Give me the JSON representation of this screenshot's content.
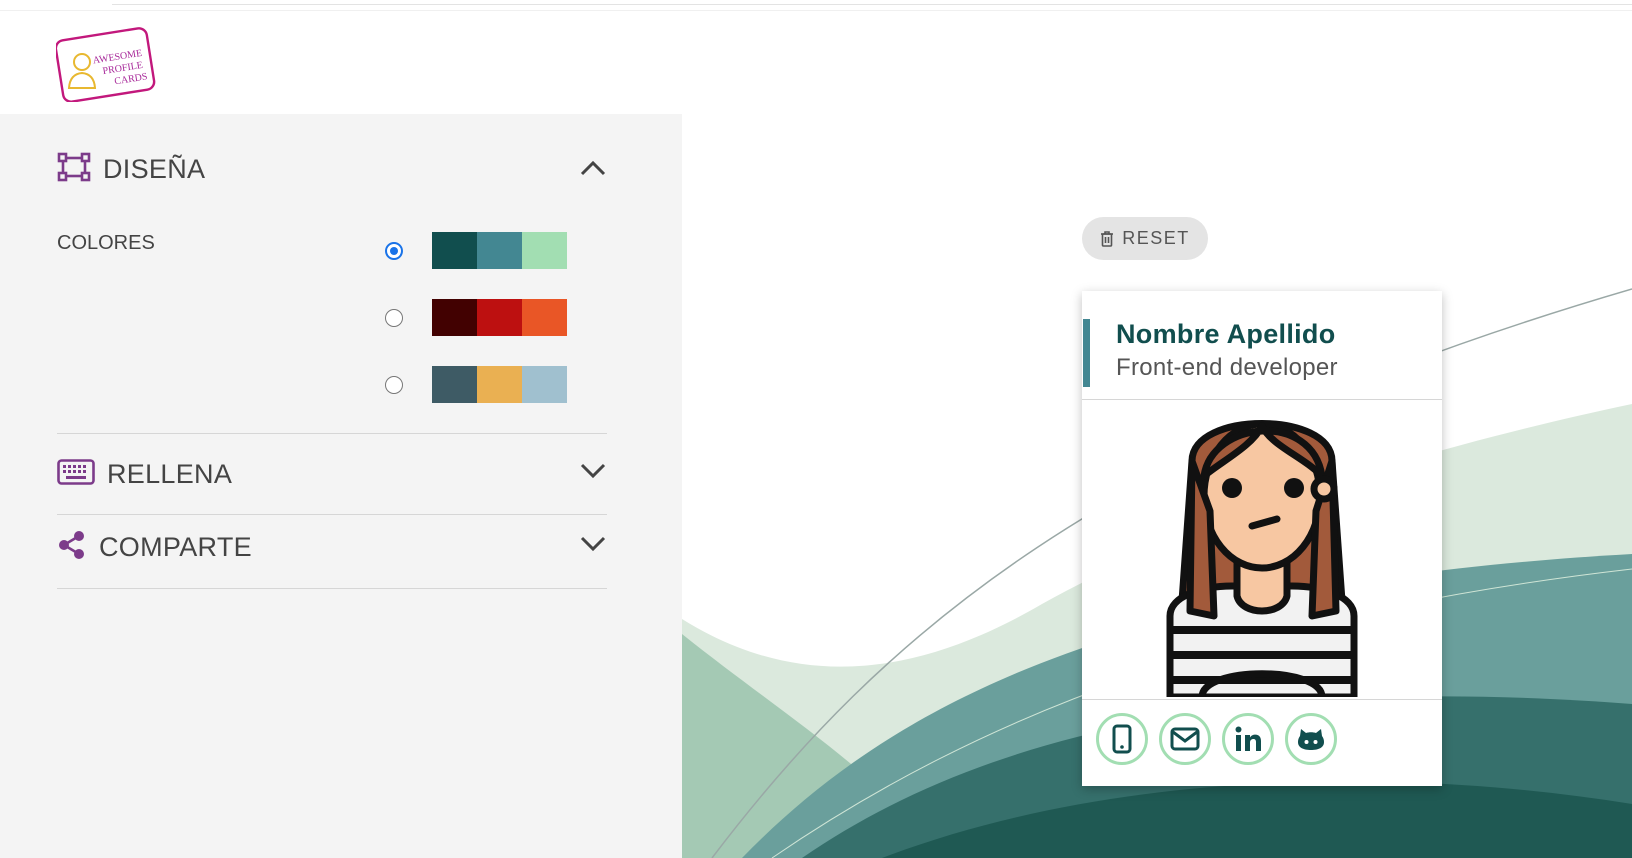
{
  "header": {
    "logo_alt": "Awesome Profile Cards",
    "logo_lines": [
      "AWESOME",
      "PROFILE",
      "CARDS"
    ]
  },
  "sections": {
    "design": {
      "title": "DISEÑA",
      "icon": "design-icon",
      "expanded": true
    },
    "fill": {
      "title": "RELLENA",
      "icon": "keyboard-icon",
      "expanded": false
    },
    "share": {
      "title": "COMPARTE",
      "icon": "share-icon",
      "expanded": false
    }
  },
  "colors": {
    "label": "COLORES",
    "selected_index": 0,
    "palettes": [
      [
        "#114e4e",
        "#438792",
        "#a2deb2"
      ],
      [
        "#420101",
        "#bd1010",
        "#e95626"
      ],
      [
        "#3e5b65",
        "#eab052",
        "#a0c0cf"
      ]
    ]
  },
  "reset": {
    "label": "RESET"
  },
  "card": {
    "name": "Nombre Apellido",
    "job": "Front-end developer",
    "accent": "#438792",
    "name_color": "#114e4e",
    "social_border": "#a2deb2",
    "socials": [
      "phone-icon",
      "email-icon",
      "linkedin-icon",
      "github-icon"
    ]
  }
}
